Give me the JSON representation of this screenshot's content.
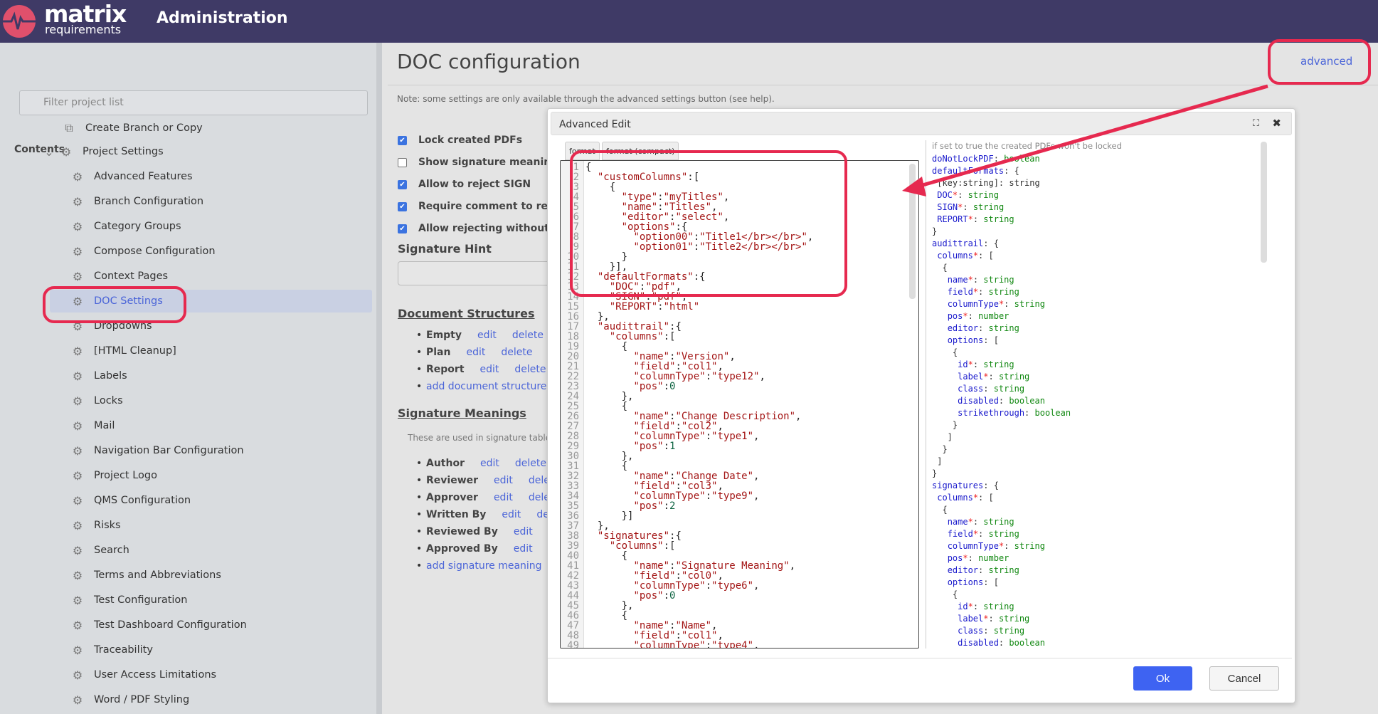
{
  "header": {
    "logo_line1": "matrix",
    "logo_line2": "requirements",
    "title": "Administration"
  },
  "sidebar": {
    "filter_placeholder": "Filter project list",
    "contents_label": "Contents",
    "create_branch": "Create Branch or Copy",
    "project_settings": "Project Settings",
    "items": [
      {
        "label": "Advanced Features"
      },
      {
        "label": "Branch Configuration"
      },
      {
        "label": "Category Groups"
      },
      {
        "label": "Compose Configuration"
      },
      {
        "label": "Context Pages"
      },
      {
        "label": "DOC Settings",
        "active": true
      },
      {
        "label": "Dropdowns"
      },
      {
        "label": "[HTML Cleanup]"
      },
      {
        "label": "Labels"
      },
      {
        "label": "Locks"
      },
      {
        "label": "Mail"
      },
      {
        "label": "Navigation Bar Configuration"
      },
      {
        "label": "Project Logo"
      },
      {
        "label": "QMS Configuration"
      },
      {
        "label": "Risks"
      },
      {
        "label": "Search"
      },
      {
        "label": "Terms and Abbreviations"
      },
      {
        "label": "Test Configuration"
      },
      {
        "label": "Test Dashboard Configuration"
      },
      {
        "label": "Traceability"
      },
      {
        "label": "User Access Limitations"
      },
      {
        "label": "Word / PDF Styling"
      }
    ]
  },
  "main": {
    "title": "DOC configuration",
    "advanced_link": "advanced",
    "note": "Note: some settings are only available through the advanced settings button (see help).",
    "checkboxes": [
      {
        "label": "Lock created PDFs",
        "checked": true
      },
      {
        "label": "Show signature meaning i",
        "checked": false
      },
      {
        "label": "Allow to reject SIGN",
        "checked": true
      },
      {
        "label": "Require comment to rejec",
        "checked": true
      },
      {
        "label": "Allow rejecting without pa",
        "checked": true
      }
    ],
    "signature_hint_label": "Signature Hint",
    "doc_structures_label": "Document Structures",
    "doc_structures": [
      {
        "name": "Empty"
      },
      {
        "name": "Plan"
      },
      {
        "name": "Report"
      }
    ],
    "add_doc_structure": "add document structure",
    "signature_meanings_label": "Signature Meanings",
    "signature_meanings_note": "These are used in signature table",
    "signature_meanings": [
      {
        "name": "Author"
      },
      {
        "name": "Reviewer"
      },
      {
        "name": "Approver"
      },
      {
        "name": "Written By"
      },
      {
        "name": "Reviewed By"
      },
      {
        "name": "Approved By"
      }
    ],
    "add_signature_meaning": "add signature meaning",
    "edit_label": "edit",
    "delete_label": "delete"
  },
  "dialog": {
    "title": "Advanced Edit",
    "format_button": "format",
    "format_compact_button": "format (compact)",
    "code_lines": [
      "{",
      "  \"customColumns\":[",
      "    {",
      "      \"type\":\"myTitles\",",
      "      \"name\":\"Titles\",",
      "      \"editor\":\"select\",",
      "      \"options\":{",
      "        \"option00\":\"Title1</br></br>\",",
      "        \"option01\":\"Title2</br></br>\"",
      "      }",
      "    }],",
      "  \"defaultFormats\":{",
      "    \"DOC\":\"pdf\",",
      "    \"SIGN\":\"pdf\",",
      "    \"REPORT\":\"html\"",
      "  },",
      "  \"audittrail\":{",
      "    \"columns\":[",
      "      {",
      "        \"name\":\"Version\",",
      "        \"field\":\"col1\",",
      "        \"columnType\":\"type12\",",
      "        \"pos\":0",
      "      },",
      "      {",
      "        \"name\":\"Change Description\",",
      "        \"field\":\"col2\",",
      "        \"columnType\":\"type1\",",
      "        \"pos\":1",
      "      },",
      "      {",
      "        \"name\":\"Change Date\",",
      "        \"field\":\"col3\",",
      "        \"columnType\":\"type9\",",
      "        \"pos\":2",
      "      }]",
      "  },",
      "  \"signatures\":{",
      "    \"columns\":[",
      "      {",
      "        \"name\":\"Signature Meaning\",",
      "        \"field\":\"col0\",",
      "        \"columnType\":\"type6\",",
      "        \"pos\":0",
      "      },",
      "      {",
      "        \"name\":\"Name\",",
      "        \"field\":\"col1\",",
      "        \"columnType\":\"type4\","
    ],
    "schema_hint": "if set to true the created PDFs won't be locked",
    "schema_lines": [
      "doNotLockPDF: boolean",
      "defaultFormats: {",
      " [key:string]: string",
      " DOC*: string",
      " SIGN*: string",
      " REPORT*: string",
      "}",
      "audittrail: {",
      " columns*: [",
      "  {",
      "   name*: string",
      "   field*: string",
      "   columnType*: string",
      "   pos*: number",
      "   editor: string",
      "   options: [",
      "    {",
      "     id*: string",
      "     label*: string",
      "     class: string",
      "     disabled: boolean",
      "     strikethrough: boolean",
      "    }",
      "   ]",
      "  }",
      " ]",
      "}",
      "signatures: {",
      " columns*: [",
      "  {",
      "   name*: string",
      "   field*: string",
      "   columnType*: string",
      "   pos*: number",
      "   editor: string",
      "   options: [",
      "    {",
      "     id*: string",
      "     label*: string",
      "     class: string",
      "     disabled: boolean"
    ],
    "ok_button": "Ok",
    "cancel_button": "Cancel"
  },
  "colors": {
    "header": "#3f3a66",
    "accent": "#4a64d8",
    "ok_button": "#3e63f2",
    "annotation": "#e6294f"
  }
}
